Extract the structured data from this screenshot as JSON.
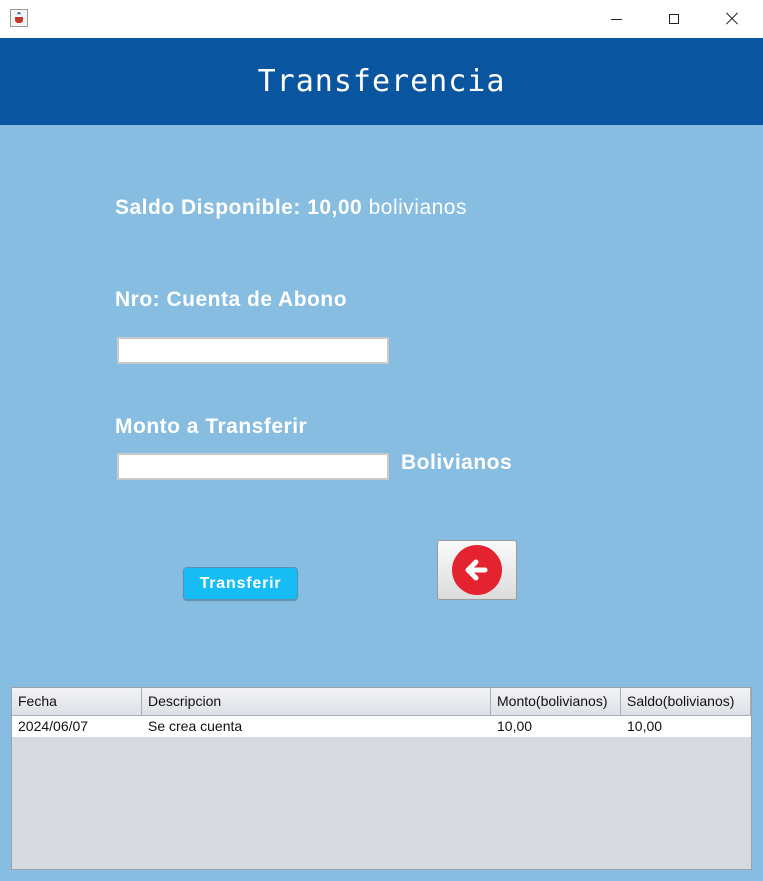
{
  "window": {
    "app_icon": "java-cup-icon",
    "controls": [
      "minimize-icon",
      "maximize-icon",
      "close-icon"
    ]
  },
  "header": {
    "title": "Transferencia"
  },
  "balance": {
    "label": "Saldo Disponible:",
    "amount": "10,00",
    "currency": "bolivianos"
  },
  "form": {
    "account_label": "Nro: Cuenta de Abono",
    "account_value": "",
    "amount_label": "Monto a Transferir",
    "amount_value": "",
    "amount_unit": "Bolivianos"
  },
  "actions": {
    "transfer_label": "Transferir",
    "back_icon": "arrow-left-circle-icon"
  },
  "colors": {
    "header_bg": "#0a55a0",
    "body_bg": "#87bde0",
    "transfer_button": "#16bdf5",
    "back_circle": "#e52330"
  },
  "table": {
    "columns": [
      "Fecha",
      "Descripcion",
      "Monto(bolivianos)",
      "Saldo(bolivianos)"
    ],
    "rows": [
      [
        "2024/06/07",
        "Se crea cuenta",
        "10,00",
        "10,00"
      ]
    ]
  }
}
